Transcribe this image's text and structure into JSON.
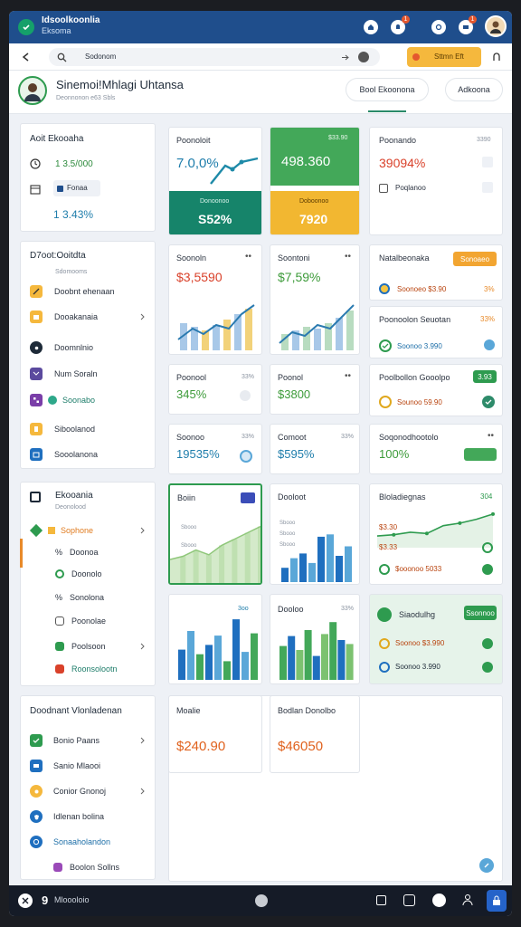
{
  "app": {
    "title": "Idsoolkoonlia",
    "subtitle": "Eksoma"
  },
  "topbar": {
    "notif_badge": "1",
    "msg_badge": "1"
  },
  "address": {
    "text": "Sodonom",
    "button_label": "Sttmn Eft"
  },
  "user": {
    "name": "Sinemoi!Mhlagi Uhtansa",
    "subtitle": "Deonnonon e63 Sbls"
  },
  "tabs": [
    {
      "label": "Bool Ekoonona"
    },
    {
      "label": "Adkoona"
    }
  ],
  "sidebar1": {
    "title": "Aoit Ekooaha",
    "value1": "1 3.5/000",
    "tag": "Fonaa",
    "value2": "1 3.43%"
  },
  "sidebar2": {
    "title": "D7oot:Ooitdta",
    "subtitle": "Sdomooms",
    "items": [
      {
        "label": "Doobnt ehenaan"
      },
      {
        "label": "Dooakanaia"
      },
      {
        "label": "Doomnlnio"
      },
      {
        "label": "Num Soraln"
      },
      {
        "label": "Soonabo"
      },
      {
        "label": "Siboolanod"
      },
      {
        "label": "Sooolanona"
      }
    ]
  },
  "sidebar3": {
    "title": "Ekooania",
    "subtitle": "Deonolood",
    "items": [
      {
        "label": "Sophone"
      },
      {
        "label": "Doonoa"
      },
      {
        "label": "Doonolo"
      },
      {
        "label": "Sonolona"
      },
      {
        "label": "Poonolae"
      },
      {
        "label": "Poolsoon"
      },
      {
        "label": "Roonsolootn"
      }
    ]
  },
  "sidebar4": {
    "title": "Doodnant Vlonladenan",
    "items": [
      {
        "label": "Bonio Paans"
      },
      {
        "label": "Sanio Mlaooi"
      },
      {
        "label": "Conior Gnonoj"
      },
      {
        "label": "Idlenan bolina"
      },
      {
        "label": "Sonaaholandon"
      },
      {
        "label": "Boolon Sollns"
      }
    ]
  },
  "row1": {
    "c1": {
      "title": "Poonoloit",
      "value": "7.0,0%"
    },
    "c2": {
      "corner": "$33.90",
      "value": "498.360"
    },
    "c3": {
      "label": "Donoonoo",
      "value": "S52%"
    },
    "c4": {
      "label": "Doboonoo",
      "value": "7920"
    },
    "c5": {
      "title": "Poonando",
      "corner": "3390",
      "value": "39094%",
      "tag": "Poqlanoo"
    }
  },
  "row2": {
    "c1": {
      "title": "Soonoln",
      "value": "$3,5590"
    },
    "c2": {
      "title": "Soontoni",
      "value": "$7,59%"
    },
    "c3": {
      "title": "Natalbeonaka",
      "button": "Sonoaeo",
      "line": "Soonoeo $3.90",
      "pct": "3%"
    },
    "c4": {
      "title": "Poonoolon Seuotan",
      "badge": "33%",
      "line": "Soonoo 3.990"
    },
    "c5": {
      "title": "Poolbollon Gooolpo",
      "badge": "3.93",
      "line": "Sounoo 59.90"
    }
  },
  "row3": {
    "c1": {
      "title": "Poonool",
      "corner": "33%",
      "value": "345%"
    },
    "c2": {
      "title": "Poonol",
      "value": "$3800"
    },
    "c3": {
      "title": "Soonoo",
      "corner": "33%",
      "value": "19535%"
    },
    "c4": {
      "title": "Comoot",
      "corner": "33%",
      "value": "$595%"
    },
    "c5": {
      "title": "Soqonodhootolo",
      "value": "100%"
    }
  },
  "row4": {
    "c1": {
      "title": "Boiin",
      "labels": [
        "Sbooo",
        "Sbooo"
      ]
    },
    "c2": {
      "title": "Dooloot",
      "labels": [
        "Sbooo",
        "Sbooo",
        "Sbooo"
      ]
    },
    "c3": {
      "title": "Bloladiegnas",
      "corner": "304",
      "lines": [
        "$3.30",
        "$3.33",
        "$ooonoo 5033"
      ]
    }
  },
  "row5": {
    "c1": {
      "corner": "3oo"
    },
    "c2": {
      "title": "Dooloo",
      "corner": "33%"
    },
    "c3": {
      "title": "Siaodulhg",
      "button": "Ssonnoo",
      "lines": [
        "Soonoo $3.990",
        "Soonoo 3.990"
      ]
    }
  },
  "row6": {
    "c1": {
      "title": "Moalie",
      "value": "$240.90"
    },
    "c2": {
      "title": "Bodlan Donolbo",
      "value": "$46050"
    }
  },
  "bottom": {
    "page": "9",
    "label": "Mloooloio"
  },
  "chart_data": [
    {
      "type": "area",
      "title": "Boiin",
      "y": [
        30,
        34,
        42,
        36,
        48,
        56,
        64,
        72
      ]
    },
    {
      "type": "bar",
      "title": "Dooloot",
      "values": [
        12,
        20,
        24,
        16,
        38,
        40,
        22,
        30
      ]
    },
    {
      "type": "line",
      "title": "Bloladiegnas",
      "y": [
        18,
        20,
        24,
        22,
        34,
        38,
        44,
        52
      ]
    },
    {
      "type": "bar",
      "series": [
        {
          "values": [
            26,
            42,
            22,
            30,
            38,
            16,
            52,
            24,
            40
          ]
        }
      ]
    },
    {
      "type": "bar",
      "title": "Dooloo",
      "values": [
        34,
        44,
        30,
        50,
        24,
        46,
        58,
        40,
        36
      ]
    }
  ]
}
